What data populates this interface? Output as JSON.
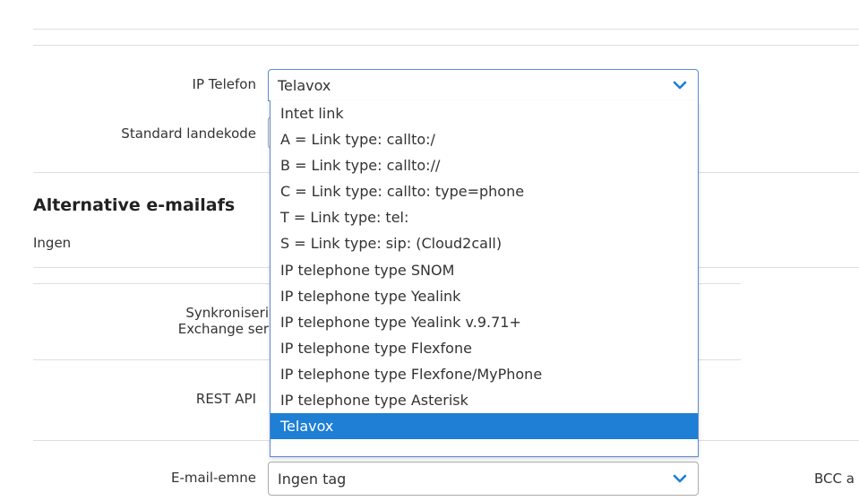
{
  "fields": {
    "ip_phone_label": "IP Telefon",
    "country_code_label": "Standard landekode",
    "alt_email_heading": "Alternative e-mailafs",
    "alt_email_value": "Ingen",
    "sync_label_line1": "Synkroniseri",
    "sync_label_line2": "Exchange ser",
    "rest_api_label": "REST API",
    "email_subject_label": "E-mail-emne",
    "email_subject_value": "Ingen tag",
    "bcc_label": "BCC a"
  },
  "ip_phone_select": {
    "value": "Telavox",
    "icon": "chevron-down-icon",
    "options": [
      "Intet link",
      "A = Link type: callto:/",
      "B = Link type: callto://",
      "C = Link type: callto: type=phone",
      "T = Link type: tel:",
      "S = Link type: sip: (Cloud2call)",
      "IP telephone type SNOM",
      "IP telephone type Yealink",
      "IP telephone type Yealink v.9.71+",
      "IP telephone type Flexfone",
      "IP telephone type Flexfone/MyPhone",
      "IP telephone type Asterisk",
      "Telavox"
    ],
    "selected_index": 12
  },
  "colors": {
    "accent": "#1e7fd5",
    "chevron": "#1e7fd5",
    "border": "#aaaaaa",
    "divider": "#dedede"
  }
}
